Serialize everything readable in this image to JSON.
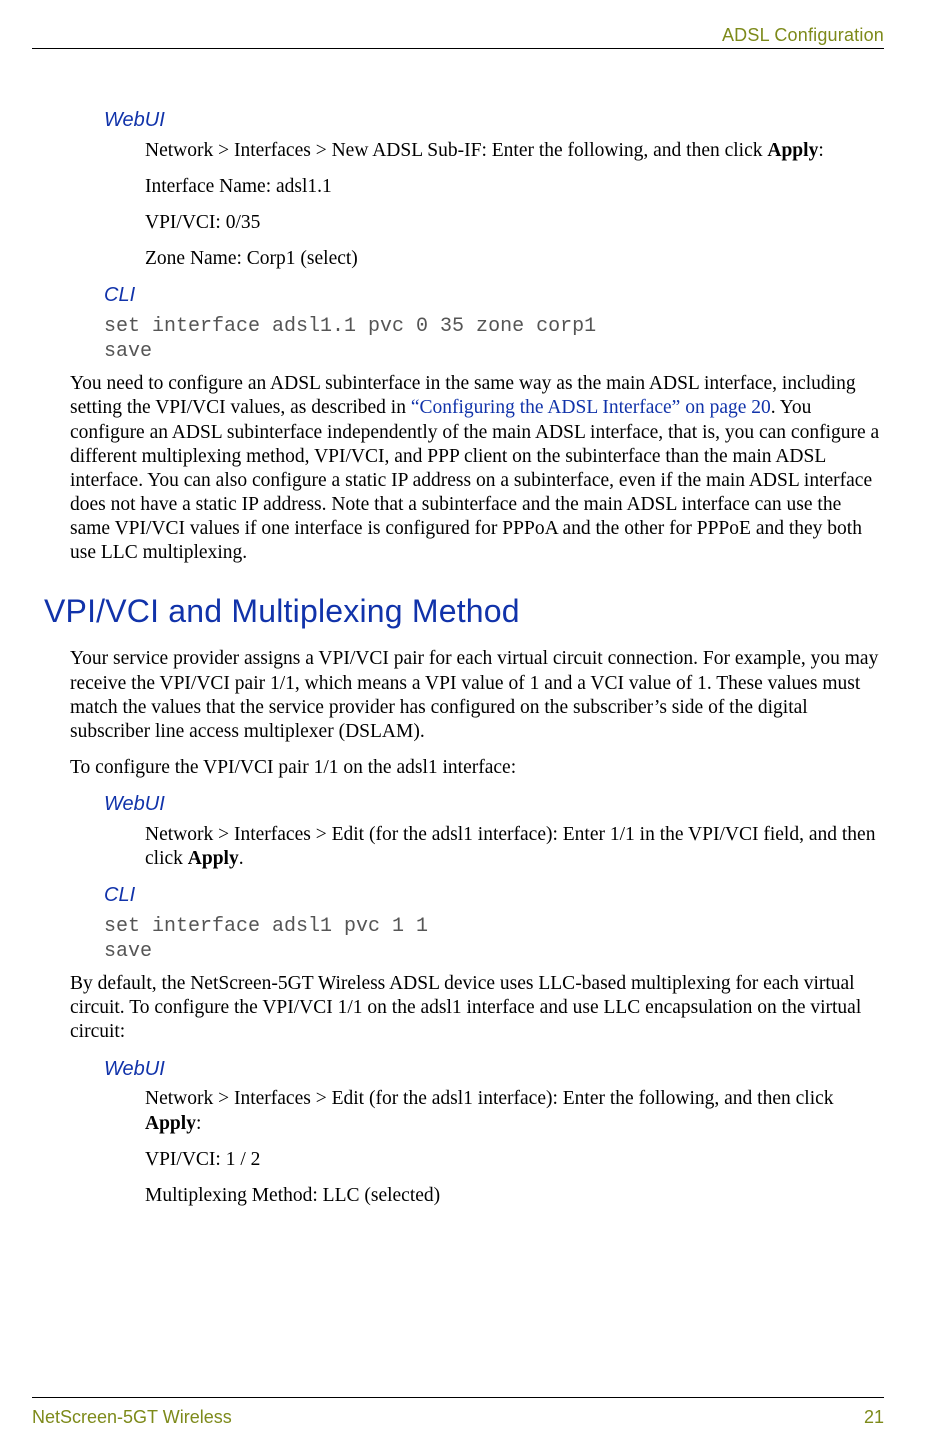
{
  "header": {
    "section_title": "ADSL Configuration"
  },
  "section1": {
    "webui_label": "WebUI",
    "web_intro_a": "Network > Interfaces > New ADSL Sub-IF: Enter the following, and then click ",
    "web_intro_b": "Apply",
    "web_intro_c": ":",
    "line_if_name": "Interface Name: adsl1.1",
    "line_vpivci": "VPI/VCI: 0/35",
    "line_zone": "Zone Name: Corp1 (select)",
    "cli_label": "CLI",
    "cli_text": "set interface adsl1.1 pvc 0 35 zone corp1\nsave",
    "body_a": "You need to configure an ADSL subinterface in the same way as the main ADSL interface, including setting the VPI/VCI values, as described in ",
    "body_link": "“Configuring the ADSL Interface” on page 20",
    "body_b": ". You configure an ADSL subinterface independently of the main ADSL interface, that is, you can configure a different multiplexing method, VPI/VCI, and PPP client on the subinterface than the main ADSL interface. You can also configure a static IP address on a subinterface, even if the main ADSL interface does not have a static IP address. Note that a subinterface and the main ADSL interface can use the same VPI/VCI values if one interface is configured for PPPoA and the other for PPPoE and they both use LLC multiplexing."
  },
  "section2": {
    "title": "VPI/VCI and Multiplexing Method",
    "para1": "Your service provider assigns a VPI/VCI pair for each virtual circuit connection. For example, you may receive the VPI/VCI pair 1/1, which means a VPI value of 1 and a VCI value of 1. These values must match the values that the service provider has configured on the subscriber’s side of the digital subscriber line access multiplexer (DSLAM).",
    "para2": "To configure the VPI/VCI pair 1/1 on the adsl1 interface:",
    "webui_label": "WebUI",
    "web_a": "Network > Interfaces > Edit (for the adsl1 interface): Enter 1/1 in the VPI/VCI field, and then click ",
    "web_b": "Apply",
    "web_c": ".",
    "cli_label": "CLI",
    "cli_text": "set interface adsl1 pvc 1 1\nsave",
    "para3": "By default, the NetScreen-5GT Wireless ADSL device uses LLC-based multiplexing for each virtual circuit. To configure the VPI/VCI 1/1 on the adsl1 interface and use LLC encapsulation on the virtual circuit:",
    "webui_label2": "WebUI",
    "web2_a": "Network > Interfaces > Edit (for the adsl1 interface): Enter the following, and then click ",
    "web2_b": "Apply",
    "web2_c": ":",
    "line_vpivci2": "VPI/VCI: 1 / 2",
    "line_mux": "Multiplexing Method: LLC (selected)"
  },
  "footer": {
    "product": "NetScreen-5GT Wireless",
    "page": "21"
  }
}
